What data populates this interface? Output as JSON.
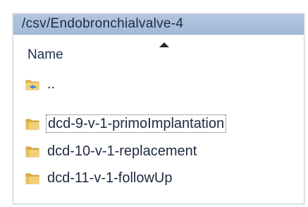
{
  "explorer": {
    "path": "/csv/Endobronchialvalve-4",
    "column_name": "Name",
    "sort_icon": "sort-ascending-icon",
    "rows": [
      {
        "label": "..",
        "icon": "parent-folder-icon"
      },
      {
        "label": "dcd-9-v-1-primoImplantation",
        "icon": "folder-icon",
        "focused": true
      },
      {
        "label": "dcd-10-v-1-replacement",
        "icon": "folder-icon"
      },
      {
        "label": "dcd-11-v-1-followUp",
        "icon": "folder-icon"
      }
    ]
  },
  "colors": {
    "path_bar": "#a8bddb",
    "folder": "#e8c35a",
    "text": "#1e2a40"
  }
}
